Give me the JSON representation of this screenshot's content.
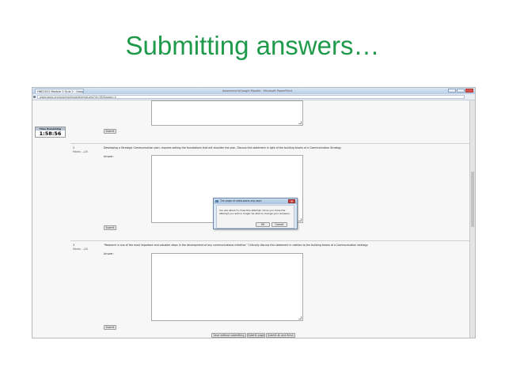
{
  "slide": {
    "title": "Submitting answers…"
  },
  "browser": {
    "tab_label": "HNE2012 Module 2 Quiz 2 - Google Chrome",
    "window_caption": "Assessment/Google Moodle - Microsoft PowerPoint",
    "url": "www.saass.org/quiz/mod/quiz/attempt.php?id=363&page=0"
  },
  "timer": {
    "label": "Time Remaining",
    "value": "1:58:56"
  },
  "questions": [
    {
      "submit_label": "Submit"
    },
    {
      "number": "2",
      "marks": "Marks: --/20",
      "text": "Developing a Strategic Communication plan, requires setting the foundations that will shoulder the plan. Discuss this statement in light of the building blocks of a Communication Strategy.",
      "answer_label": "Answer:",
      "submit_label": "Submit"
    },
    {
      "number": "3",
      "marks": "Marks: --/20",
      "text": "\"Research is one of the most important and valuable steps in the development of any communications initiative.\" Critically discuss this statement in relation to the building blocks of a Communication strategy.",
      "answer_label": "Answer:",
      "submit_label": "Submit"
    }
  ],
  "dialog": {
    "title": "The page at www.saass.org says:",
    "close_glyph": "x",
    "message": "You are about to close this attempt. Once you close the attempt you will no longer be able to change your answers.",
    "ok_label": "OK",
    "cancel_label": "Cancel"
  },
  "footer": {
    "save_without_submitting": "Save without submitting",
    "submit_page": "Submit page",
    "submit_all_and_finish": "Submit all and finish"
  }
}
